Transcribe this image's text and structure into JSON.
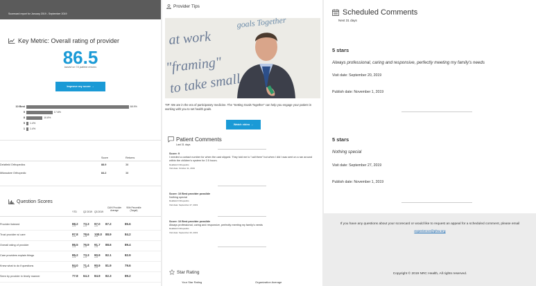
{
  "header": {
    "report_period": "Scorecard report for January 2019 - September 2019"
  },
  "key_metric": {
    "title": "Key Metric: Overall rating of provider",
    "score": "86.5",
    "subtitle": "based on 74 patient returns",
    "improve_label": "Improve my score →"
  },
  "distribution": [
    {
      "label": "10 Best",
      "pct_label": "68.9%",
      "value": 68.9
    },
    {
      "label": "9",
      "pct_label": "17.6%",
      "value": 17.6
    },
    {
      "label": "8",
      "pct_label": "10.8%",
      "value": 10.8
    },
    {
      "label": "5",
      "pct_label": "1.4%",
      "value": 1.4
    },
    {
      "label": "1",
      "pct_label": "1.4%",
      "value": 1.4
    }
  ],
  "comparison": {
    "headers": [
      "Score",
      "Returns"
    ],
    "rows": [
      {
        "name": "Delafield Orthopedics",
        "score": "88.9",
        "returns": "38"
      },
      {
        "name": "Milwaukee Orthopedic",
        "score": "84.2",
        "returns": "38"
      }
    ]
  },
  "question_scores": {
    "title": "Question Scores",
    "headers": [
      "YTD",
      "Q2 2019",
      "Q3 2019",
      "CAHI Provider Average",
      "90th Percentile (Target)"
    ],
    "rows": [
      {
        "q": "Provider listened",
        "vals": [
          "88.2",
          "73.3",
          "97.0",
          "87.2",
          "85.6"
        ],
        "ns": [
          "n=76",
          "n=15",
          "n=33"
        ]
      },
      {
        "q": "Trust provider w/ care",
        "vals": [
          "87.8",
          "78.6",
          "100.0",
          "88.9",
          "84.2"
        ],
        "ns": [
          "n=74",
          "n=14",
          "n=36"
        ]
      },
      {
        "q": "Overall rating of provider",
        "vals": [
          "86.5",
          "76.9",
          "91.7",
          "88.6",
          "89.4"
        ],
        "ns": [
          "n=74",
          "n=13",
          "n=36"
        ]
      },
      {
        "q": "Care providers explain things",
        "vals": [
          "85.2",
          "73.3",
          "90.9",
          "82.1",
          "82.9"
        ],
        "ns": [
          "n=74",
          "n=15",
          "n=33"
        ]
      },
      {
        "q": "Knew what to do if questions",
        "vals": [
          "84.0",
          "71.4",
          "90.9",
          "81.9",
          "79.6"
        ],
        "ns": [
          "n=75",
          "n=14",
          "n=33"
        ]
      },
      {
        "q": "Seen by provider in timely manner",
        "vals": [
          "77.8",
          "64.3",
          "84.9",
          "82.3",
          "89.2"
        ],
        "ns": []
      }
    ]
  },
  "tips": {
    "title": "Provider Tips",
    "text": "TIP: We are in the era of participatory medicine. The \"Setting Goals Together\" can help you engage your patient in working with you to set health goals.",
    "watch_label": "Watch video →",
    "board_lines": [
      "goals Together",
      "at work",
      "\"framing\"",
      "to take small"
    ]
  },
  "patient_comments": {
    "title": "Patient Comments",
    "subtitle": "Last 31 days",
    "items": [
      {
        "score": "Score: 9",
        "text": "I needed a contact number for when the cast slipped. They told me to \"call them\" but when I did I was sent on a ran around within the children's system for 2.5 hours.",
        "location": "Delafield Orthopedics",
        "visit": "Visit date: October 11, 2019"
      },
      {
        "score": "Score: 10 Best provider possible",
        "text": "Nothing special",
        "location": "Delafield Orthopedics",
        "visit": "Visit date: September 27, 2019"
      },
      {
        "score": "Score: 10 Best provider possible",
        "text": "Always professional, caring and responsive, perfectly meeting my family's needs",
        "location": "Delafield Orthopedics",
        "visit": "Visit date: September 20, 2019"
      }
    ]
  },
  "star_rating": {
    "title": "Star Rating",
    "your_label": "Your Star Rating",
    "org_label": "Organization Average"
  },
  "scheduled": {
    "title": "Scheduled Comments",
    "subtitle": "Next 31 days",
    "items": [
      {
        "stars": "5 stars",
        "quote": "Always professional, caring and responsive, perfectly meeting my family's needs",
        "visit": "Visit date: September 20, 2019",
        "publish": "Publish date: November 1, 2019"
      },
      {
        "stars": "5 stars",
        "quote": "Nothing special",
        "visit": "Visit date: September 27, 2019",
        "publish": "Publish date: November 1, 2019"
      }
    ]
  },
  "footer": {
    "question_text": "If you have any questions about your scorecard or would like to request an appeal for a scheduled comment, please email",
    "email": "experience@phw.org",
    "copyright": "Copyright © 2019 NRC Health, All rights reserved."
  },
  "colors": {
    "accent": "#1a9ad6",
    "header_bg": "#5b5b5b",
    "bar": "#777777"
  }
}
